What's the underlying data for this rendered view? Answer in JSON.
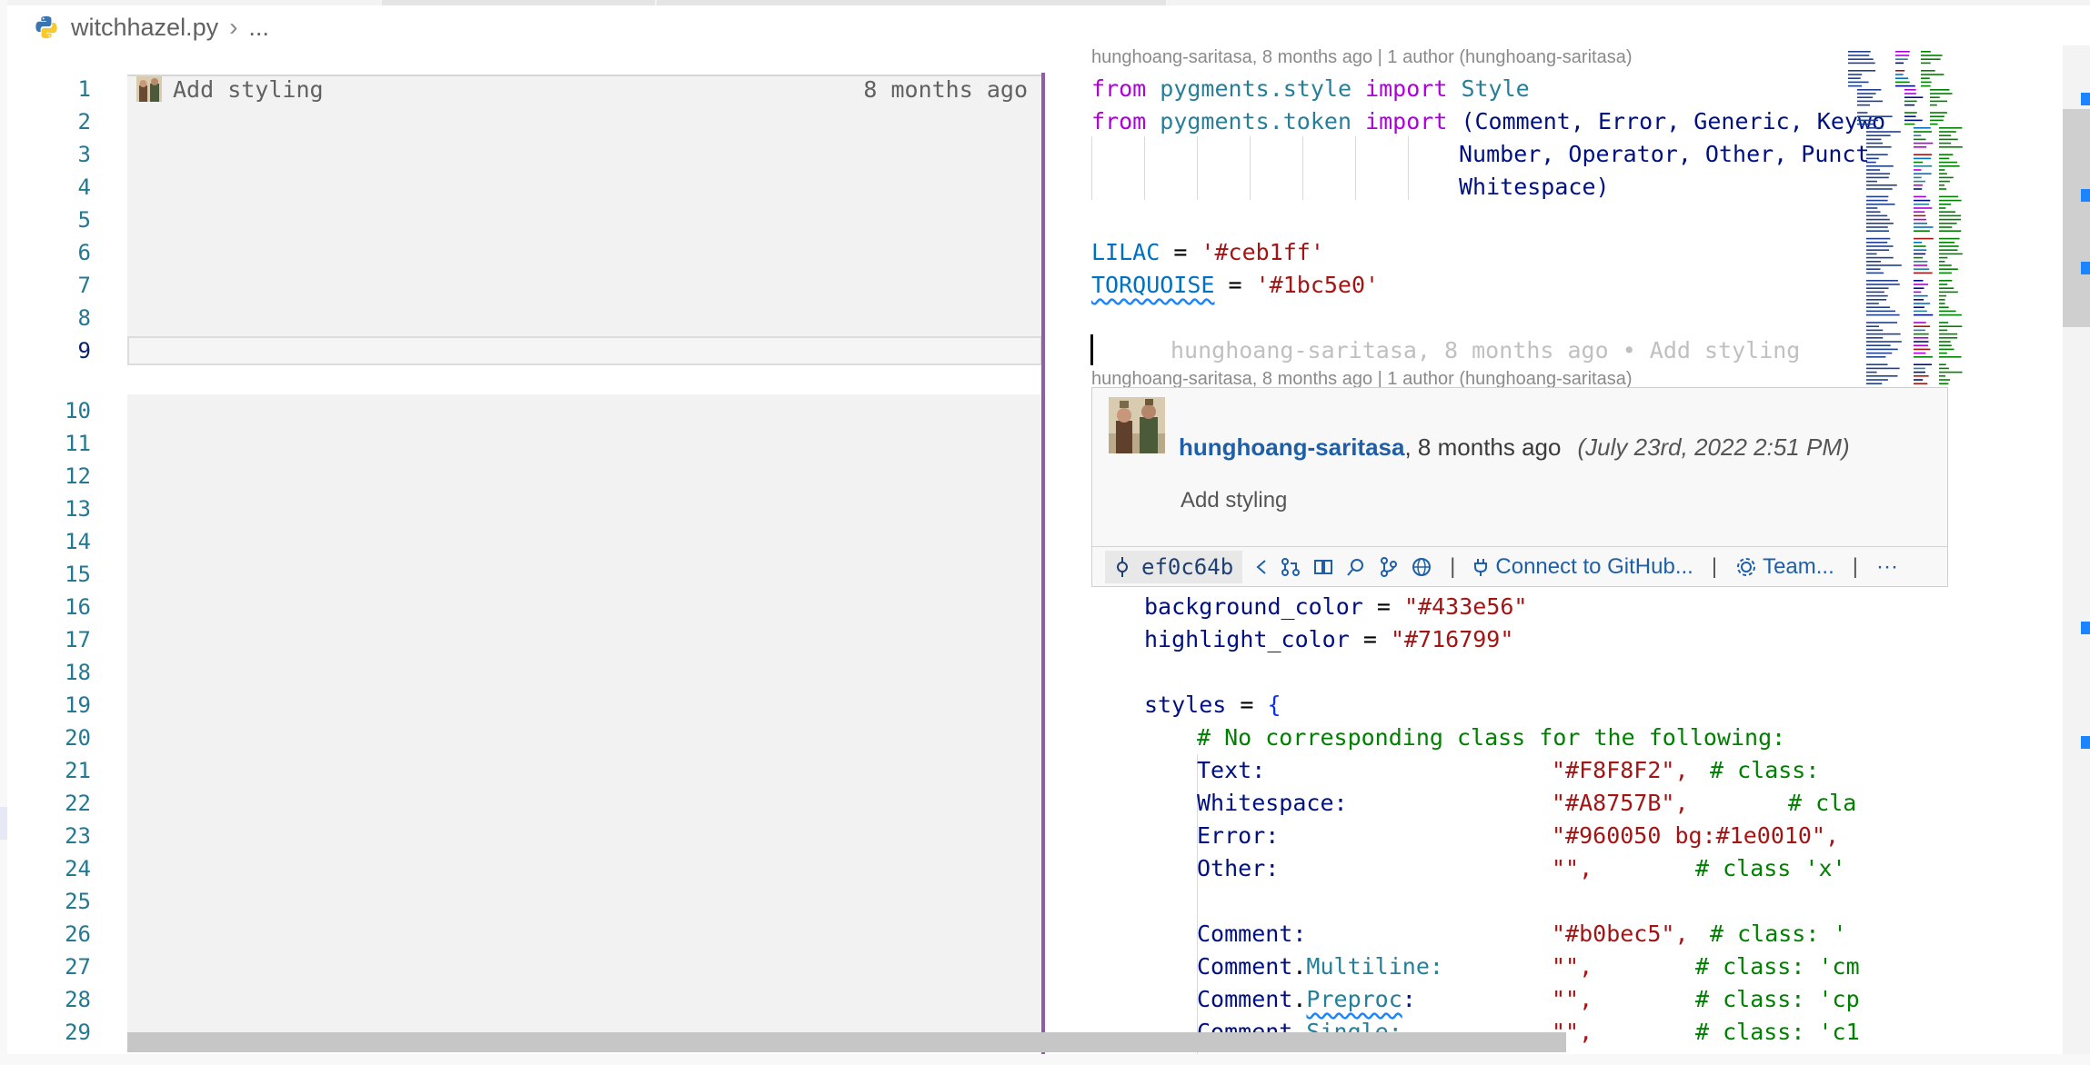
{
  "breadcrumb": {
    "file": "witchhazel.py",
    "more": "..."
  },
  "line_numbers": [
    "1",
    "2",
    "3",
    "4",
    "5",
    "6",
    "7",
    "8",
    "9",
    "10",
    "11",
    "12",
    "13",
    "14",
    "15",
    "16",
    "17",
    "18",
    "19",
    "20",
    "21",
    "22",
    "23",
    "24",
    "25",
    "26",
    "27",
    "28",
    "29"
  ],
  "blame": {
    "message": "Add styling",
    "age": "8 months ago"
  },
  "codelens": {
    "top": "hunghoang-saritasa, 8 months ago | 1 author (hunghoang-saritasa)",
    "mid": "hunghoang-saritasa, 8 months ago | 1 author (hunghoang-saritasa)"
  },
  "ghost_blame": "hunghoang-saritasa, 8 months ago • Add styling",
  "code": {
    "l1": {
      "kw1": "from",
      "mod": "pygments.style",
      "kw2": "import",
      "cls": "Style"
    },
    "l2": {
      "kw1": "from",
      "mod": "pygments.token",
      "kw2": "import",
      "rest": "(Comment, Error, Generic, Keywo"
    },
    "l3": "Number, Operator, Other, Punct",
    "l4": "Whitespace)",
    "l6": {
      "name": "LILAC",
      "eq": " = ",
      "val": "'#ceb1ff'"
    },
    "l7": {
      "name": "TORQUOISE",
      "eq": " = ",
      "val": "'#1bc5e0'"
    },
    "l16": {
      "name": "background_color",
      "eq": " = ",
      "val": "\"#433e56\""
    },
    "l17": {
      "name": "highlight_color",
      "eq": " = ",
      "val": "\"#716799\""
    },
    "l19": {
      "name": "styles",
      "eq": " = ",
      "brace": "{"
    },
    "l20": "# No corresponding class for the following:",
    "l21": {
      "name": "Text:",
      "val": "\"#F8F8F2\",",
      "cmt": "# class:"
    },
    "l22": {
      "name": "Whitespace:",
      "val": "\"#A8757B\",",
      "cmt": "# cla"
    },
    "l23": {
      "name": "Error:",
      "val": "\"#960050 bg:#1e0010\","
    },
    "l24": {
      "name": "Other:",
      "val": "\"\",",
      "cmt": "# class 'x'"
    },
    "l26": {
      "name": "Comment:",
      "val": "\"#b0bec5\",",
      "cmt": "# class: '"
    },
    "l27": {
      "a": "Comment",
      "dot": ".",
      "b": "Multiline:",
      "val": "\"\",",
      "cmt": "# class: 'cm"
    },
    "l28": {
      "a": "Comment",
      "dot": ".",
      "b": "Preproc",
      "c": ":",
      "val": "\"\",",
      "cmt": "# class: 'cp"
    },
    "l29": {
      "a": "Comment",
      "dot": ".",
      "b": "Single:",
      "val": "\"\",",
      "cmt": "# class: 'c1"
    }
  },
  "hover": {
    "author": "hunghoang-saritasa",
    "age": ", 8 months ago",
    "date": "(July 23rd, 2022 2:51 PM)",
    "message": "Add styling",
    "sha": "ef0c64b",
    "connect": "Connect to GitHub...",
    "team": "Team...",
    "pipe": "|",
    "more": "···"
  },
  "colors": {
    "accent": "#8f5ea6",
    "link": "#1f5fa8",
    "lineno": "#237893"
  }
}
